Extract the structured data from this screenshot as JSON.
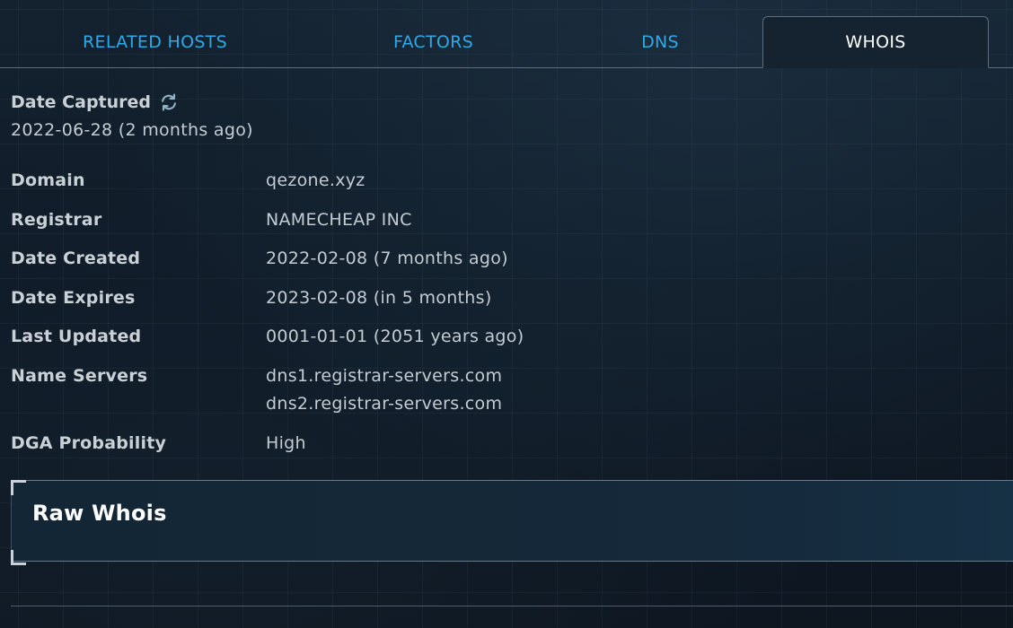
{
  "tabs": [
    {
      "label": "RELATED HOSTS"
    },
    {
      "label": "FACTORS"
    },
    {
      "label": "DNS"
    },
    {
      "label": "WHOIS"
    }
  ],
  "active_tab": "WHOIS",
  "captured": {
    "label": "Date Captured",
    "value": "2022-06-28 (2 months ago)",
    "icon": "refresh-icon"
  },
  "whois": {
    "domain": {
      "label": "Domain",
      "value": "qezone.xyz"
    },
    "registrar": {
      "label": "Registrar",
      "value": "NAMECHEAP INC"
    },
    "date_created": {
      "label": "Date Created",
      "value": "2022-02-08 (7 months ago)"
    },
    "date_expires": {
      "label": "Date Expires",
      "value": "2023-02-08 (in 5 months)"
    },
    "last_updated": {
      "label": "Last Updated",
      "value": "0001-01-01 (2051 years ago)"
    },
    "name_servers": {
      "label": "Name Servers",
      "values": [
        "dns1.registrar-servers.com",
        "dns2.registrar-servers.com"
      ]
    },
    "dga_probability": {
      "label": "DGA Probability",
      "value": "High"
    }
  },
  "raw_whois": {
    "title": "Raw Whois"
  },
  "colors": {
    "tab_link": "#2ea9e6",
    "tab_active": "#ffffff",
    "background": "#0f1823"
  }
}
